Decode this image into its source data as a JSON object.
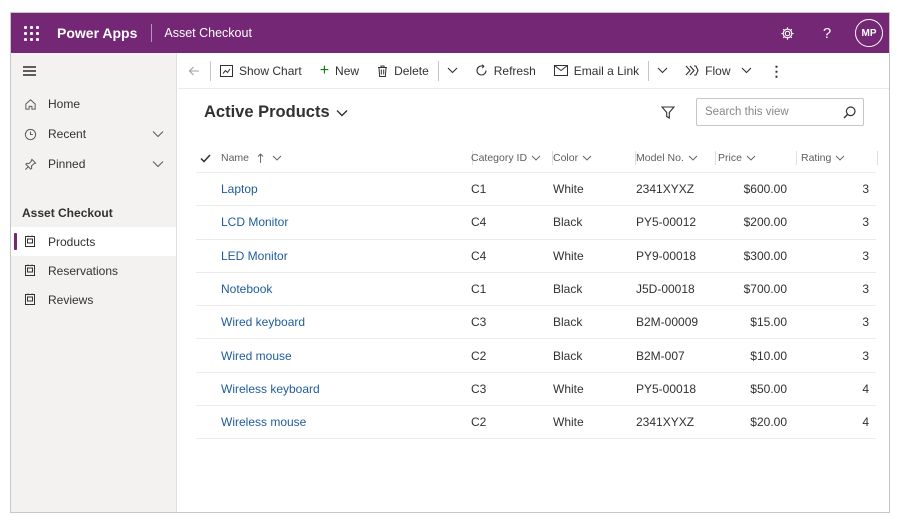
{
  "topbar": {
    "app_name": "Power Apps",
    "app_title": "Asset Checkout",
    "avatar_initials": "MP",
    "brand_color": "#742774"
  },
  "sidebar": {
    "items": [
      {
        "label": "Home",
        "icon": "home-icon"
      },
      {
        "label": "Recent",
        "icon": "clock-icon"
      },
      {
        "label": "Pinned",
        "icon": "pin-icon"
      }
    ],
    "group_label": "Asset Checkout",
    "entities": [
      {
        "label": "Products",
        "icon": "entity-icon",
        "active": true
      },
      {
        "label": "Reservations",
        "icon": "entity-icon",
        "active": false
      },
      {
        "label": "Reviews",
        "icon": "entity-icon",
        "active": false
      }
    ]
  },
  "command_bar": {
    "show_chart": "Show Chart",
    "new": "New",
    "delete": "Delete",
    "refresh": "Refresh",
    "email_link": "Email a Link",
    "flow": "Flow"
  },
  "view": {
    "title": "Active Products",
    "search_placeholder": "Search this view"
  },
  "table": {
    "columns": [
      "Name",
      "Category ID",
      "Color",
      "Model No.",
      "Price",
      "Rating"
    ],
    "rows": [
      {
        "name": "Laptop",
        "category": "C1",
        "color": "White",
        "model": "2341XYXZ",
        "price": "$600.00",
        "rating": "3"
      },
      {
        "name": "LCD Monitor",
        "category": "C4",
        "color": "Black",
        "model": "PY5-00012",
        "price": "$200.00",
        "rating": "3"
      },
      {
        "name": "LED Monitor",
        "category": "C4",
        "color": "White",
        "model": "PY9-00018",
        "price": "$300.00",
        "rating": "3"
      },
      {
        "name": "Notebook",
        "category": "C1",
        "color": "Black",
        "model": "J5D-00018",
        "price": "$700.00",
        "rating": "3"
      },
      {
        "name": "Wired keyboard",
        "category": "C3",
        "color": "Black",
        "model": "B2M-00009",
        "price": "$15.00",
        "rating": "3"
      },
      {
        "name": "Wired mouse",
        "category": "C2",
        "color": "Black",
        "model": "B2M-007",
        "price": "$10.00",
        "rating": "3"
      },
      {
        "name": "Wireless keyboard",
        "category": "C3",
        "color": "White",
        "model": "PY5-00018",
        "price": "$50.00",
        "rating": "4"
      },
      {
        "name": "Wireless mouse",
        "category": "C2",
        "color": "White",
        "model": "2341XYXZ",
        "price": "$20.00",
        "rating": "4"
      }
    ]
  }
}
